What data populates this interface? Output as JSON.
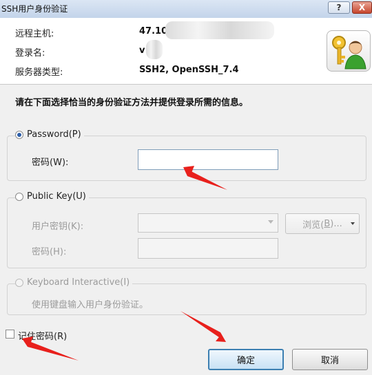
{
  "window": {
    "title": "SSH用户身份验证",
    "help_label": "?",
    "close_label": "X"
  },
  "info": {
    "host_label": "远程主机:",
    "host_value": "47.10",
    "login_label": "登录名:",
    "login_value": "v",
    "server_type_label": "服务器类型:",
    "server_type_value": "SSH2, OpenSSH_7.4"
  },
  "instruction": "请在下面选择恰当的身份验证方法并提供登录所需的信息。",
  "password_method": {
    "label": "Password",
    "mnemonic": "(P)",
    "selected": true,
    "field_label": "密码",
    "field_mnemonic": "(W)",
    "field_suffix": ":",
    "value": ""
  },
  "public_key_method": {
    "label": "Public Key",
    "mnemonic": "(U)",
    "selected": false,
    "key_label": "用户密钥",
    "key_mnemonic": "(K)",
    "key_suffix": ":",
    "browse_label": "浏览(",
    "browse_mnemonic": "B",
    "browse_suffix": ")...",
    "passphrase_label": "密码",
    "passphrase_mnemonic": "(H)",
    "passphrase_suffix": ":"
  },
  "keyboard_interactive_method": {
    "label": "Keyboard Interactive",
    "mnemonic": "(I)",
    "description": "使用键盘输入用户身份验证。"
  },
  "remember_password": {
    "label": "记住密码",
    "mnemonic": "(R)",
    "checked": false
  },
  "buttons": {
    "ok": "确定",
    "cancel": "取消"
  },
  "colors": {
    "annotation_arrow": "#e8201c",
    "default_button_border": "#3c7fb1",
    "radio_selected": "#2d5ea8"
  },
  "icons": {
    "dialog_icon": "key-user-icon",
    "browse_dropdown": "chevron-down-icon"
  }
}
